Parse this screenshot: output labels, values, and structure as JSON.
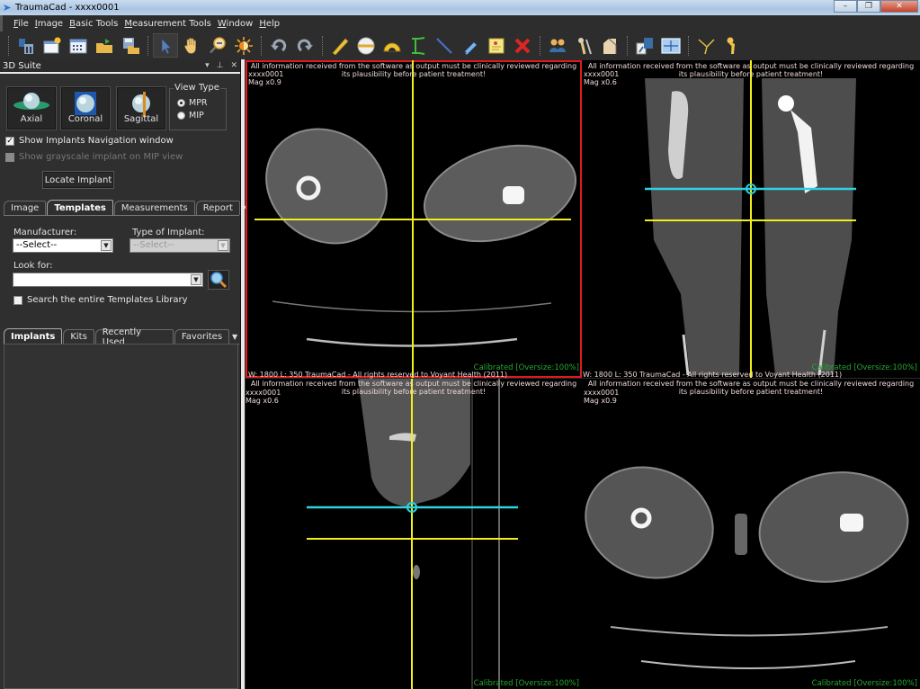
{
  "window": {
    "title": "TraumaCad - xxxx0001",
    "controls": {
      "minimize": "–",
      "restore": "❐",
      "close": "✕"
    }
  },
  "menubar": [
    {
      "label": "File",
      "accel": "F"
    },
    {
      "label": "Image",
      "accel": "I"
    },
    {
      "label": "Basic Tools",
      "accel": "B"
    },
    {
      "label": "Measurement Tools",
      "accel": "M"
    },
    {
      "label": "Window",
      "accel": "W"
    },
    {
      "label": "Help",
      "accel": "H"
    }
  ],
  "toolbar": {
    "groups": [
      [
        "patient-icon",
        "new-image-icon",
        "gallery-icon",
        "open-folder-icon",
        "save-icon"
      ],
      [
        "pointer-icon",
        "pan-hand-icon",
        "zoom-icon",
        "brightness-icon"
      ],
      [
        "undo-icon",
        "redo-icon"
      ],
      [
        "ruler-icon",
        "circle-icon",
        "protractor-icon",
        "caliper-icon",
        "line-icon",
        "pen-icon",
        "note-icon",
        "delete-icon"
      ],
      [
        "compare-icon",
        "hip-template-icon",
        "knee-template-icon"
      ],
      [
        "split-view-icon",
        "layout-icon"
      ],
      [
        "angle-tool-icon",
        "femur-icon"
      ]
    ],
    "active": "pointer-icon"
  },
  "panel": {
    "title": "3D Suite",
    "view_buttons": [
      {
        "label": "Axial",
        "icon": "axial-view-icon"
      },
      {
        "label": "Coronal",
        "icon": "coronal-view-icon"
      },
      {
        "label": "Sagittal",
        "icon": "sagittal-view-icon"
      }
    ],
    "view_type": {
      "legend": "View Type",
      "options": [
        "MPR",
        "MIP"
      ],
      "selected": "MPR"
    },
    "show_nav_window": {
      "label": "Show Implants Navigation window",
      "checked": true
    },
    "show_grayscale": {
      "label": "Show grayscale  implant on MIP view",
      "checked": false,
      "disabled": true
    },
    "locate_button": "Locate Implant",
    "tabs": [
      "Image",
      "Templates",
      "Measurements",
      "Report"
    ],
    "selected_tab": "Templates",
    "manufacturer": {
      "label": "Manufacturer:",
      "value": "--Select--"
    },
    "implant_type": {
      "label": "Type of Implant:",
      "value": "--Select--",
      "disabled": true
    },
    "look_for": {
      "label": "Look for:",
      "value": ""
    },
    "search_library": {
      "label": "Search the entire Templates Library",
      "checked": false
    },
    "sub_tabs": [
      "Implants",
      "Kits",
      "Recently Used",
      "Favorites"
    ],
    "selected_sub_tab": "Implants"
  },
  "viewports": [
    {
      "id": "axial",
      "selected": true,
      "warning": "All information received from the software as output must be clinically reviewed regarding its plausibility before patient treatment!",
      "patient": "xxxx0001",
      "mag": "Mag x0.9",
      "calibration": "Calibrated [Oversize:100%]",
      "footer": "W:  1800 L: 350     TraumaCad -  All rights reserved to Voyant Health  (2011)"
    },
    {
      "id": "coronal",
      "selected": false,
      "warning": "All information received from the software as output must be clinically reviewed regarding its plausibility before patient treatment!",
      "patient": "xxxx0001",
      "mag": "Mag x0.6",
      "calibration": "Calibrated [Oversize:100%]",
      "footer": "W:  1800 L: 350     TraumaCad -  All rights reserved to Voyant Health  (2011)"
    },
    {
      "id": "sagittal",
      "selected": false,
      "warning": "All information received from the software as output must be clinically reviewed regarding its plausibility before patient treatment!",
      "patient": "xxxx0001",
      "mag": "Mag x0.6",
      "calibration": "Calibrated [Oversize:100%]"
    },
    {
      "id": "axial-2",
      "selected": false,
      "warning": "All information received from the software as output must be clinically reviewed regarding its plausibility before patient treatment!",
      "patient": "xxxx0001",
      "mag": "Mag x0.9",
      "calibration": "Calibrated [Oversize:100%]"
    }
  ],
  "colors": {
    "crosshair": "#f2ee1a",
    "slice_line": "#2fd3e0",
    "selection": "#e0191e",
    "calibrated": "#27a832"
  }
}
